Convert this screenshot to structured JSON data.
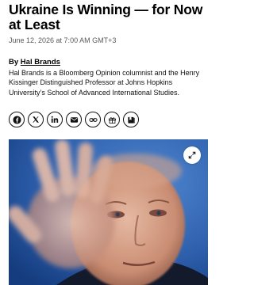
{
  "article": {
    "headline": "Ukraine Is Winning — for Now at Least",
    "dateline": "June 12, 2026 at 7:00 AM GMT+3",
    "byline_prefix": "By ",
    "author": "Hal Brands",
    "bio": "Hal Brands is a Bloomberg Opinion columnist and the Henry Kissinger Distinguished Professor at Johns Hopkins University’s School of Advanced International Studies."
  },
  "share": {
    "buttons": [
      {
        "icon": "facebook-icon"
      },
      {
        "icon": "x-icon"
      },
      {
        "icon": "linkedin-icon"
      },
      {
        "icon": "email-icon"
      },
      {
        "icon": "link-icon"
      },
      {
        "icon": "gift-icon"
      },
      {
        "icon": "bookmark-icon"
      }
    ]
  },
  "hero": {
    "icon": "expand-icon",
    "colors": {
      "background": "#2a5aa6",
      "skin": "#d9a78f"
    }
  }
}
